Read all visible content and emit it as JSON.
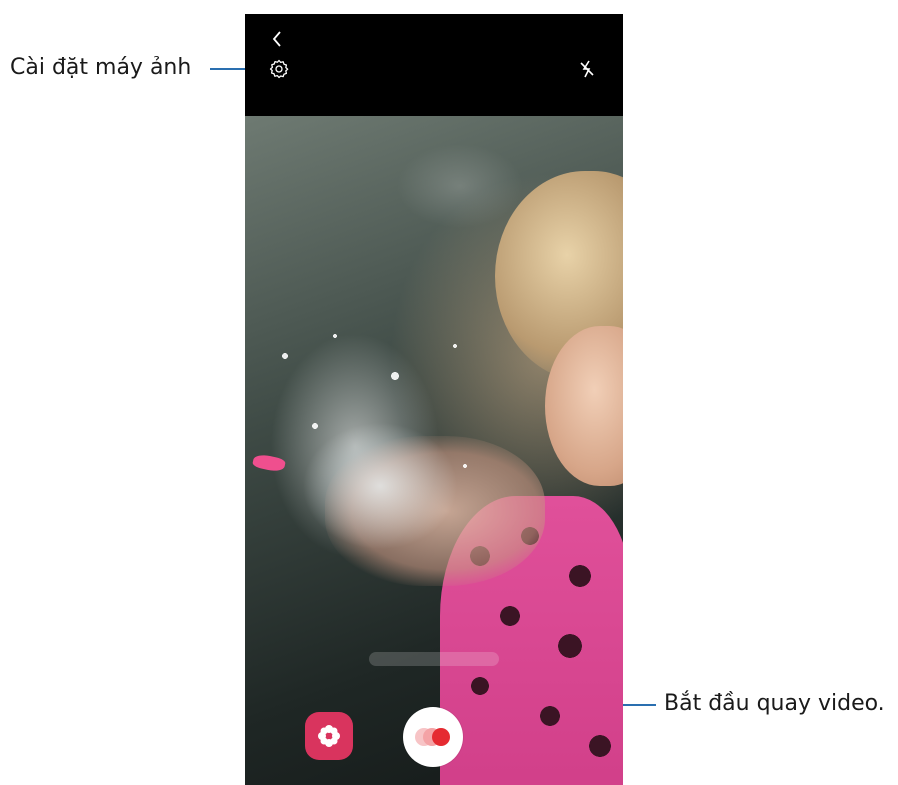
{
  "callouts": {
    "camera_settings": "Cài đặt máy ảnh",
    "start_recording": "Bắt đầu quay video."
  },
  "icons": {
    "back": "chevron-left-icon",
    "settings": "gear-icon",
    "flash": "flash-off-icon",
    "gallery": "flower-icon",
    "record": "record-button"
  },
  "colors": {
    "callout_line": "#2a6fb0",
    "gallery_button": "#d9345e",
    "record_dot_primary": "#e52a31",
    "record_dot_faded": "#f4a3a6"
  }
}
